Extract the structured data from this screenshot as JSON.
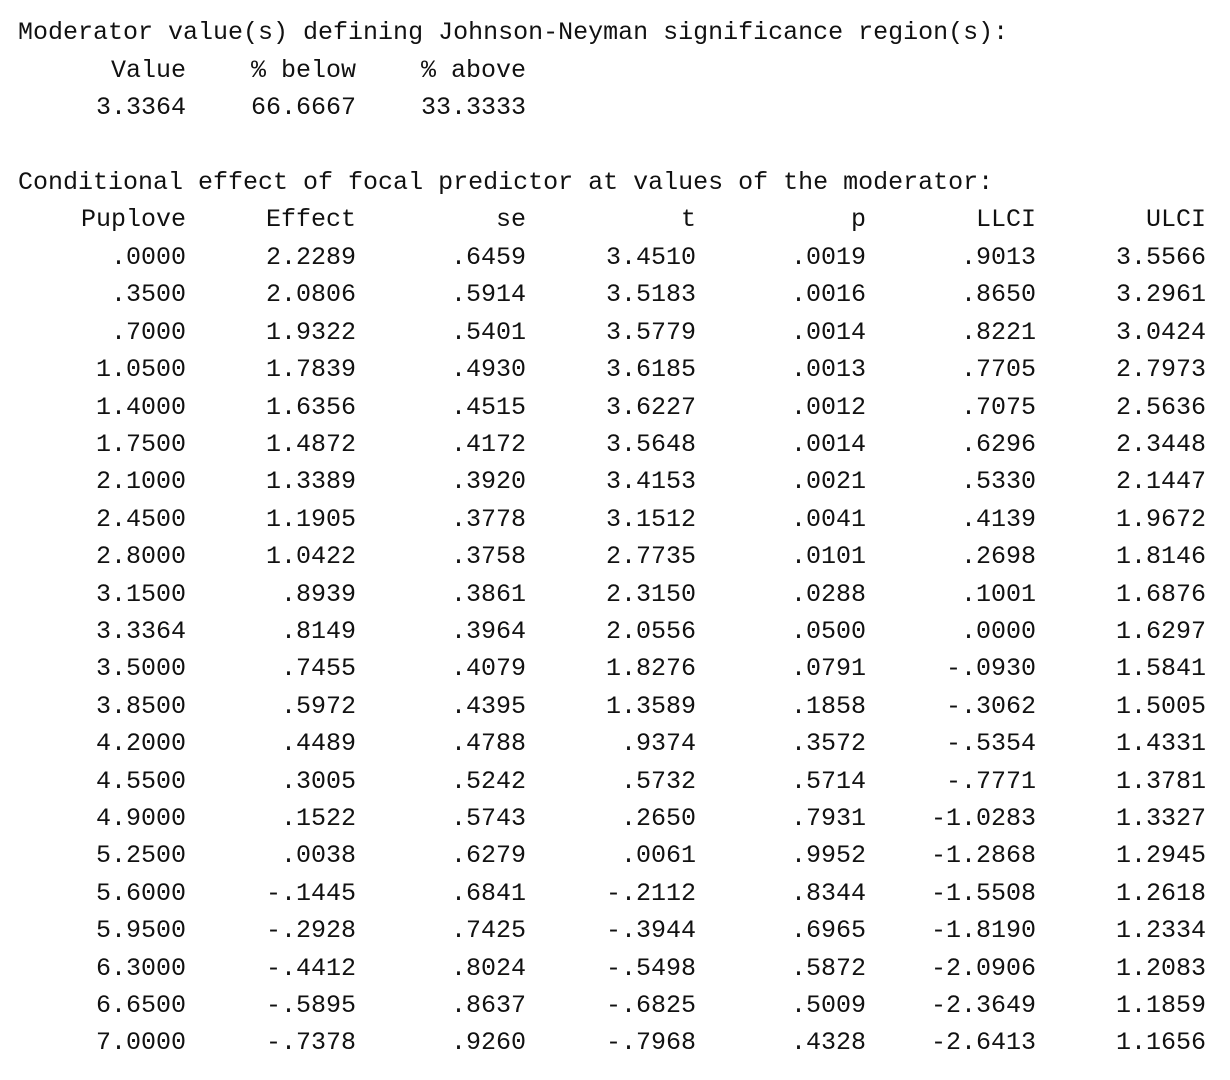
{
  "jn": {
    "heading": "Moderator value(s) defining Johnson-Neyman significance region(s):",
    "headers": [
      "Value",
      "% below",
      "% above"
    ],
    "rows": [
      [
        "3.3364",
        "66.6667",
        "33.3333"
      ]
    ]
  },
  "conditional": {
    "heading": "Conditional effect of focal predictor at values of the moderator:",
    "headers": [
      "Puplove",
      "Effect",
      "se",
      "t",
      "p",
      "LLCI",
      "ULCI"
    ],
    "rows": [
      [
        ".0000",
        "2.2289",
        ".6459",
        "3.4510",
        ".0019",
        ".9013",
        "3.5566"
      ],
      [
        ".3500",
        "2.0806",
        ".5914",
        "3.5183",
        ".0016",
        ".8650",
        "3.2961"
      ],
      [
        ".7000",
        "1.9322",
        ".5401",
        "3.5779",
        ".0014",
        ".8221",
        "3.0424"
      ],
      [
        "1.0500",
        "1.7839",
        ".4930",
        "3.6185",
        ".0013",
        ".7705",
        "2.7973"
      ],
      [
        "1.4000",
        "1.6356",
        ".4515",
        "3.6227",
        ".0012",
        ".7075",
        "2.5636"
      ],
      [
        "1.7500",
        "1.4872",
        ".4172",
        "3.5648",
        ".0014",
        ".6296",
        "2.3448"
      ],
      [
        "2.1000",
        "1.3389",
        ".3920",
        "3.4153",
        ".0021",
        ".5330",
        "2.1447"
      ],
      [
        "2.4500",
        "1.1905",
        ".3778",
        "3.1512",
        ".0041",
        ".4139",
        "1.9672"
      ],
      [
        "2.8000",
        "1.0422",
        ".3758",
        "2.7735",
        ".0101",
        ".2698",
        "1.8146"
      ],
      [
        "3.1500",
        ".8939",
        ".3861",
        "2.3150",
        ".0288",
        ".1001",
        "1.6876"
      ],
      [
        "3.3364",
        ".8149",
        ".3964",
        "2.0556",
        ".0500",
        ".0000",
        "1.6297"
      ],
      [
        "3.5000",
        ".7455",
        ".4079",
        "1.8276",
        ".0791",
        "-.0930",
        "1.5841"
      ],
      [
        "3.8500",
        ".5972",
        ".4395",
        "1.3589",
        ".1858",
        "-.3062",
        "1.5005"
      ],
      [
        "4.2000",
        ".4489",
        ".4788",
        ".9374",
        ".3572",
        "-.5354",
        "1.4331"
      ],
      [
        "4.5500",
        ".3005",
        ".5242",
        ".5732",
        ".5714",
        "-.7771",
        "1.3781"
      ],
      [
        "4.9000",
        ".1522",
        ".5743",
        ".2650",
        ".7931",
        "-1.0283",
        "1.3327"
      ],
      [
        "5.2500",
        ".0038",
        ".6279",
        ".0061",
        ".9952",
        "-1.2868",
        "1.2945"
      ],
      [
        "5.6000",
        "-.1445",
        ".6841",
        "-.2112",
        ".8344",
        "-1.5508",
        "1.2618"
      ],
      [
        "5.9500",
        "-.2928",
        ".7425",
        "-.3944",
        ".6965",
        "-1.8190",
        "1.2334"
      ],
      [
        "6.3000",
        "-.4412",
        ".8024",
        "-.5498",
        ".5872",
        "-2.0906",
        "1.2083"
      ],
      [
        "6.6500",
        "-.5895",
        ".8637",
        "-.6825",
        ".5009",
        "-2.3649",
        "1.1859"
      ],
      [
        "7.0000",
        "-.7378",
        ".9260",
        "-.7968",
        ".4328",
        "-2.6413",
        "1.1656"
      ]
    ]
  }
}
